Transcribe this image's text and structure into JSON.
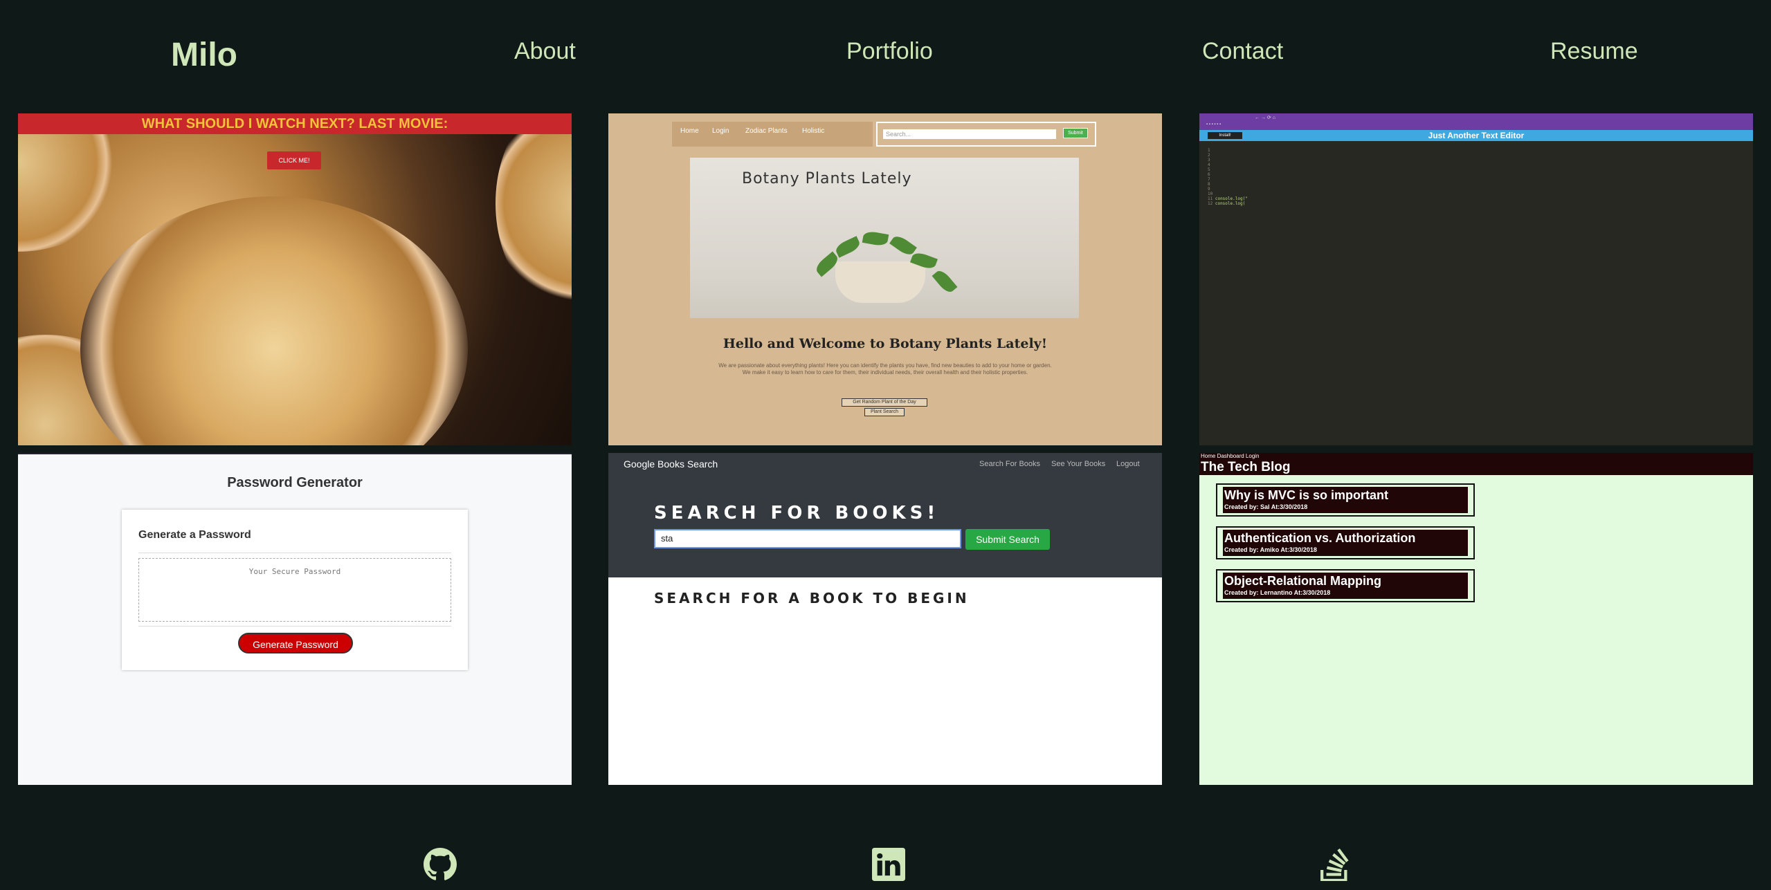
{
  "nav": {
    "logo": "Milo",
    "items": [
      "About",
      "Portfolio",
      "Contact",
      "Resume"
    ]
  },
  "projects": {
    "movie": {
      "banner": "WHAT SHOULD I WATCH NEXT? LAST MOVIE:",
      "button": "CLICK ME!"
    },
    "botany": {
      "nav": [
        "Home",
        "Login",
        "Zodiac Plants",
        "Holistic"
      ],
      "search_placeholder": "Search...",
      "submit": "Submit",
      "hero_title": "Botany Plants Lately",
      "welcome": "Hello and Welcome to Botany Plants Lately!",
      "description": "We are passionate about everything plants! Here you can identify the plants you have, find new beauties to add to your home or garden. We make it easy to learn how to care for them, their individual needs, their overall health and their holistic properties.",
      "btn_random": "Get Random Plant of the Day",
      "btn_search": "Plant Search"
    },
    "editor": {
      "install": "Install!",
      "title": "Just Another Text Editor"
    },
    "password": {
      "heading": "Password Generator",
      "card_title": "Generate a Password",
      "placeholder": "Your Secure Password",
      "button": "Generate Password"
    },
    "books": {
      "brand": "Google Books Search",
      "links": [
        "Search For Books",
        "See Your Books",
        "Logout"
      ],
      "heading": "SEARCH FOR BOOKS!",
      "input_value": "sta",
      "submit": "Submit Search",
      "begin": "SEARCH FOR A BOOK TO BEGIN"
    },
    "blog": {
      "nav": "Home Dashboard Login",
      "title": "The Tech Blog",
      "posts": [
        {
          "title": "Why is MVC is so important",
          "meta": "Created by: Sal At:3/30/2018"
        },
        {
          "title": "Authentication vs. Authorization",
          "meta": "Created by: Amiko At:3/30/2018"
        },
        {
          "title": "Object-Relational Mapping",
          "meta": "Created by: Lernantino At:3/30/2018"
        }
      ]
    }
  },
  "footer": {
    "icons": [
      "github-icon",
      "linkedin-icon",
      "stackoverflow-icon"
    ]
  },
  "colors": {
    "background": "#0f1a18",
    "text": "#cfe6b8"
  }
}
